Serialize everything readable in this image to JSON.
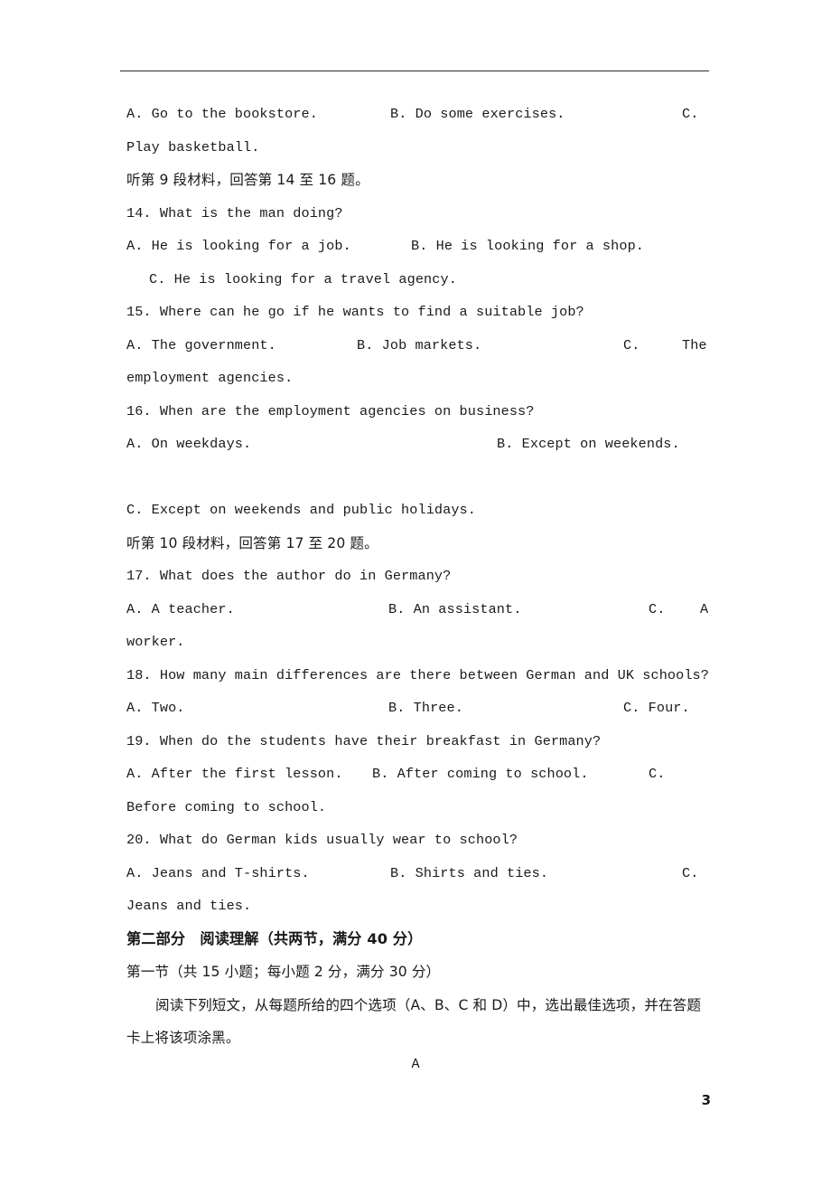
{
  "page": {
    "number": "3",
    "section_letter": "A"
  },
  "listening": {
    "q13_options_continued": {
      "a": "A. Go to the bookstore.",
      "b": "B. Do some exercises.",
      "c_label": "C.",
      "c_rest": "Play basketball."
    },
    "directive_9": "听第 9 段材料，回答第 14 至 16 题。",
    "directive_10": "听第 10 段材料，回答第 17 至 20 题。",
    "questions": [
      {
        "stem": "14. What is the man doing?",
        "a": "A. He is looking for a job.",
        "b": "B. He is looking for a shop.",
        "c": "C. He is looking for a travel agency."
      },
      {
        "stem": "15. Where can he go if he wants to find a suitable job?",
        "a": "A. The government.",
        "b": "B. Job markets.",
        "c_label": "C.",
        "c_head": "The",
        "c_rest": "employment agencies."
      },
      {
        "stem": "16. When are the employment agencies on business?",
        "a": "A. On weekdays.",
        "b": "B. Except on weekends.",
        "c": "C. Except on weekends and public holidays."
      },
      {
        "stem": "17. What does the author do in Germany?",
        "a": "A. A teacher.",
        "b": "B. An assistant.",
        "c_label": "C.",
        "c_head": "A",
        "c_rest": "worker."
      },
      {
        "stem": "18. How many main differences are there between German and UK schools?",
        "a": "A. Two.",
        "b": "B. Three.",
        "c": "C. Four."
      },
      {
        "stem": "19. When do the students have their breakfast in Germany?",
        "a": "A. After the first lesson.",
        "b": "B. After coming to school.",
        "c_label": "C.",
        "c_rest": "Before coming to school."
      },
      {
        "stem": "20. What do German kids usually wear to school?",
        "a": "A. Jeans and T-shirts.",
        "b": "B. Shirts and ties.",
        "c_label": "C.",
        "c_rest": "Jeans and ties."
      }
    ]
  },
  "reading": {
    "part_heading": "第二部分　阅读理解（共两节，满分 40 分）",
    "section_heading": "第一节（共 15 小题；每小题 2 分，满分 30 分）",
    "instruction_line1": "阅读下列短文，从每题所给的四个选项（A、B、C 和 D）中，选出最佳选项，并在答题",
    "instruction_line2": "卡上将该项涂黑。"
  }
}
